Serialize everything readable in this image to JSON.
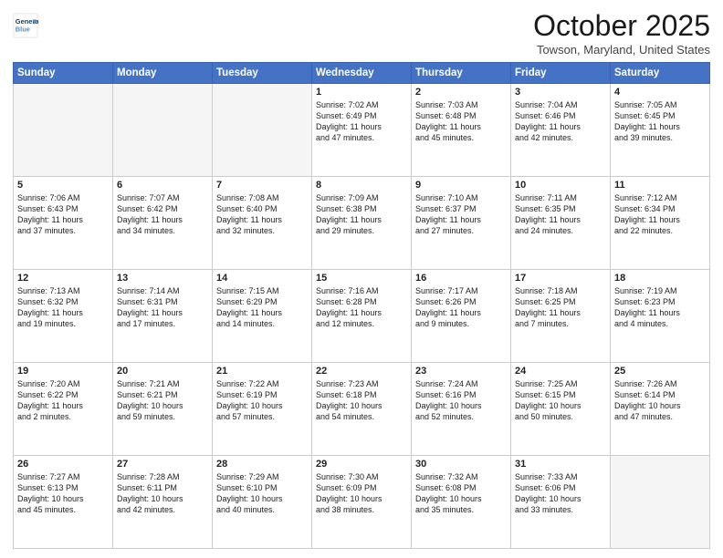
{
  "header": {
    "logo_line1": "General",
    "logo_line2": "Blue",
    "title": "October 2025",
    "location": "Towson, Maryland, United States"
  },
  "weekdays": [
    "Sunday",
    "Monday",
    "Tuesday",
    "Wednesday",
    "Thursday",
    "Friday",
    "Saturday"
  ],
  "weeks": [
    [
      {
        "day": "",
        "info": ""
      },
      {
        "day": "",
        "info": ""
      },
      {
        "day": "",
        "info": ""
      },
      {
        "day": "1",
        "info": "Sunrise: 7:02 AM\nSunset: 6:49 PM\nDaylight: 11 hours\nand 47 minutes."
      },
      {
        "day": "2",
        "info": "Sunrise: 7:03 AM\nSunset: 6:48 PM\nDaylight: 11 hours\nand 45 minutes."
      },
      {
        "day": "3",
        "info": "Sunrise: 7:04 AM\nSunset: 6:46 PM\nDaylight: 11 hours\nand 42 minutes."
      },
      {
        "day": "4",
        "info": "Sunrise: 7:05 AM\nSunset: 6:45 PM\nDaylight: 11 hours\nand 39 minutes."
      }
    ],
    [
      {
        "day": "5",
        "info": "Sunrise: 7:06 AM\nSunset: 6:43 PM\nDaylight: 11 hours\nand 37 minutes."
      },
      {
        "day": "6",
        "info": "Sunrise: 7:07 AM\nSunset: 6:42 PM\nDaylight: 11 hours\nand 34 minutes."
      },
      {
        "day": "7",
        "info": "Sunrise: 7:08 AM\nSunset: 6:40 PM\nDaylight: 11 hours\nand 32 minutes."
      },
      {
        "day": "8",
        "info": "Sunrise: 7:09 AM\nSunset: 6:38 PM\nDaylight: 11 hours\nand 29 minutes."
      },
      {
        "day": "9",
        "info": "Sunrise: 7:10 AM\nSunset: 6:37 PM\nDaylight: 11 hours\nand 27 minutes."
      },
      {
        "day": "10",
        "info": "Sunrise: 7:11 AM\nSunset: 6:35 PM\nDaylight: 11 hours\nand 24 minutes."
      },
      {
        "day": "11",
        "info": "Sunrise: 7:12 AM\nSunset: 6:34 PM\nDaylight: 11 hours\nand 22 minutes."
      }
    ],
    [
      {
        "day": "12",
        "info": "Sunrise: 7:13 AM\nSunset: 6:32 PM\nDaylight: 11 hours\nand 19 minutes."
      },
      {
        "day": "13",
        "info": "Sunrise: 7:14 AM\nSunset: 6:31 PM\nDaylight: 11 hours\nand 17 minutes."
      },
      {
        "day": "14",
        "info": "Sunrise: 7:15 AM\nSunset: 6:29 PM\nDaylight: 11 hours\nand 14 minutes."
      },
      {
        "day": "15",
        "info": "Sunrise: 7:16 AM\nSunset: 6:28 PM\nDaylight: 11 hours\nand 12 minutes."
      },
      {
        "day": "16",
        "info": "Sunrise: 7:17 AM\nSunset: 6:26 PM\nDaylight: 11 hours\nand 9 minutes."
      },
      {
        "day": "17",
        "info": "Sunrise: 7:18 AM\nSunset: 6:25 PM\nDaylight: 11 hours\nand 7 minutes."
      },
      {
        "day": "18",
        "info": "Sunrise: 7:19 AM\nSunset: 6:23 PM\nDaylight: 11 hours\nand 4 minutes."
      }
    ],
    [
      {
        "day": "19",
        "info": "Sunrise: 7:20 AM\nSunset: 6:22 PM\nDaylight: 11 hours\nand 2 minutes."
      },
      {
        "day": "20",
        "info": "Sunrise: 7:21 AM\nSunset: 6:21 PM\nDaylight: 10 hours\nand 59 minutes."
      },
      {
        "day": "21",
        "info": "Sunrise: 7:22 AM\nSunset: 6:19 PM\nDaylight: 10 hours\nand 57 minutes."
      },
      {
        "day": "22",
        "info": "Sunrise: 7:23 AM\nSunset: 6:18 PM\nDaylight: 10 hours\nand 54 minutes."
      },
      {
        "day": "23",
        "info": "Sunrise: 7:24 AM\nSunset: 6:16 PM\nDaylight: 10 hours\nand 52 minutes."
      },
      {
        "day": "24",
        "info": "Sunrise: 7:25 AM\nSunset: 6:15 PM\nDaylight: 10 hours\nand 50 minutes."
      },
      {
        "day": "25",
        "info": "Sunrise: 7:26 AM\nSunset: 6:14 PM\nDaylight: 10 hours\nand 47 minutes."
      }
    ],
    [
      {
        "day": "26",
        "info": "Sunrise: 7:27 AM\nSunset: 6:13 PM\nDaylight: 10 hours\nand 45 minutes."
      },
      {
        "day": "27",
        "info": "Sunrise: 7:28 AM\nSunset: 6:11 PM\nDaylight: 10 hours\nand 42 minutes."
      },
      {
        "day": "28",
        "info": "Sunrise: 7:29 AM\nSunset: 6:10 PM\nDaylight: 10 hours\nand 40 minutes."
      },
      {
        "day": "29",
        "info": "Sunrise: 7:30 AM\nSunset: 6:09 PM\nDaylight: 10 hours\nand 38 minutes."
      },
      {
        "day": "30",
        "info": "Sunrise: 7:32 AM\nSunset: 6:08 PM\nDaylight: 10 hours\nand 35 minutes."
      },
      {
        "day": "31",
        "info": "Sunrise: 7:33 AM\nSunset: 6:06 PM\nDaylight: 10 hours\nand 33 minutes."
      },
      {
        "day": "",
        "info": ""
      }
    ]
  ]
}
